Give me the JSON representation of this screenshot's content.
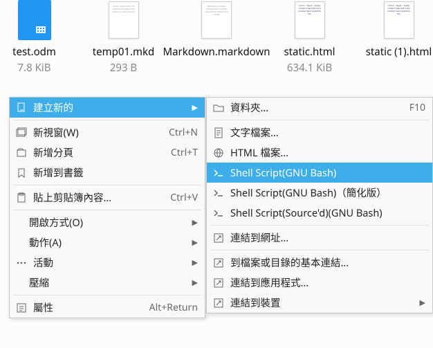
{
  "files": [
    {
      "name": "test.odm",
      "size": "7.8 KiB",
      "kind": "odm"
    },
    {
      "name": "temp01.mkd",
      "size": "293 B",
      "kind": "txt"
    },
    {
      "name": "Markdown.markdown",
      "size": "",
      "kind": "txt"
    },
    {
      "name": "static.html",
      "size": "634.1 KiB",
      "kind": "html"
    },
    {
      "name": "static (1).html",
      "size": "",
      "kind": "html"
    }
  ],
  "menu": {
    "create_new": "建立新的",
    "new_window": "新視窗(W)",
    "new_window_sc": "Ctrl+N",
    "new_tab": "新增分頁",
    "new_tab_sc": "Ctrl+T",
    "add_bookmark": "新增到書籤",
    "paste_clipboard": "貼上剪貼簿內容...",
    "paste_sc": "Ctrl+V",
    "open_with": "開啟方式(O)",
    "actions": "動作(A)",
    "activity": "活動",
    "compress": "壓縮",
    "properties": "屬性",
    "properties_sc": "Alt+Return"
  },
  "submenu": {
    "folder": "資料夾...",
    "folder_sc": "F10",
    "text_file": "文字檔案...",
    "html_file": "HTML 檔案...",
    "shell_bash": "Shell Script(GNU Bash)",
    "shell_simple": "Shell Script(GNU Bash)（簡化版）",
    "shell_sourced": "Shell Script(Source'd)(GNU Bash)",
    "link_url": "連結到網址...",
    "link_basic": "到檔案或目錄的基本連結...",
    "link_app": "連結到應用程式...",
    "link_device": "連結到裝置"
  }
}
